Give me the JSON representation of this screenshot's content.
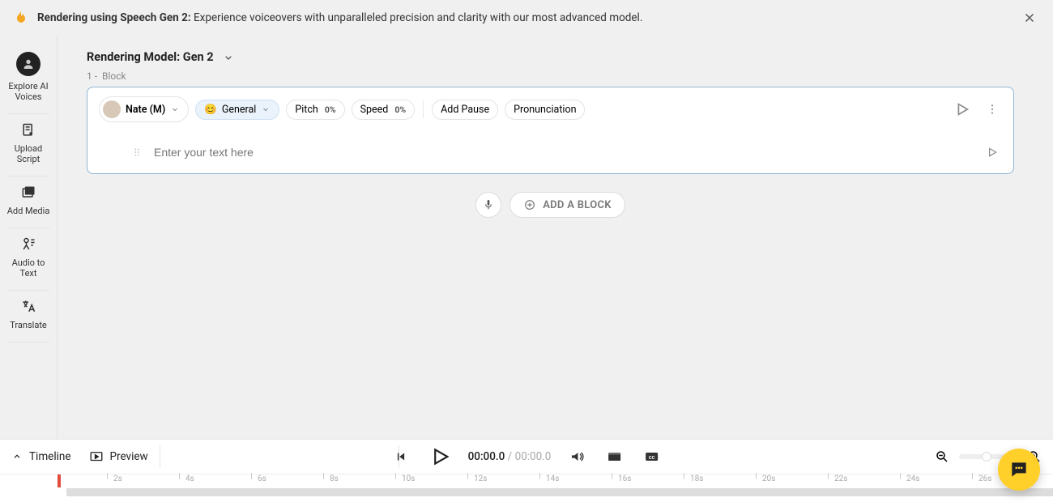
{
  "banner": {
    "bold": "Rendering using Speech Gen 2:",
    "rest": " Experience voiceovers with unparalleled precision and clarity with our most advanced model."
  },
  "sidebar": {
    "explore": "Explore AI Voices",
    "upload": "Upload Script",
    "media": "Add Media",
    "audio_text": "Audio to Text",
    "translate": "Translate"
  },
  "model": {
    "label": "Rendering Model: Gen 2"
  },
  "block": {
    "index": "1 -",
    "name": "Block",
    "voice": "Nate (M)",
    "emotion": "General",
    "pitch_label": "Pitch",
    "pitch_value": "0%",
    "speed_label": "Speed",
    "speed_value": "0%",
    "add_pause": "Add Pause",
    "pronunciation": "Pronunciation",
    "placeholder": "Enter your text here"
  },
  "add": {
    "label": "ADD A BLOCK"
  },
  "footer": {
    "timeline": "Timeline",
    "preview": "Preview",
    "current": "00:00.0",
    "sep": " / ",
    "duration": "00:00.0"
  },
  "ticks": [
    "2s",
    "4s",
    "6s",
    "8s",
    "10s",
    "12s",
    "14s",
    "16s",
    "18s",
    "20s",
    "22s",
    "24s",
    "26s"
  ]
}
